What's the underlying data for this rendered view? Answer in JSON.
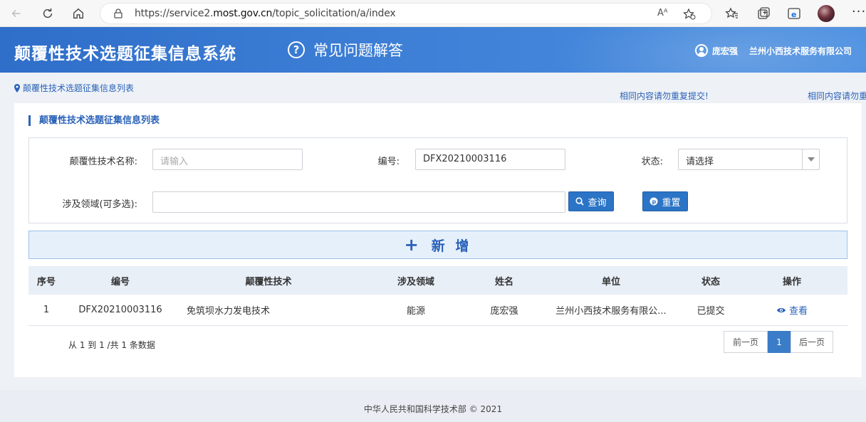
{
  "browser": {
    "url_prefix": "https://service2.",
    "url_domain": "most.gov.cn",
    "url_path": "/topic_solicitation/a/index",
    "read_aloud": "Aᴬ"
  },
  "header": {
    "title": "颠覆性技术选题征集信息系统",
    "faq_label": "常见问题解答",
    "user_name": "庞宏强",
    "company": "兰州小西技术服务有限公司"
  },
  "breadcrumb": {
    "label": "颠覆性技术选题征集信息列表"
  },
  "notices": [
    "相同内容请勿重复提交!",
    "相同内容请勿重"
  ],
  "section": {
    "title": "颠覆性技术选题征集信息列表"
  },
  "filters": {
    "name_label": "颠覆性技术名称:",
    "name_placeholder": "请输入",
    "code_label": "编号:",
    "code_value": "DFX20210003116",
    "status_label": "状态:",
    "status_value": "请选择",
    "field_label": "涉及领域(可多选):",
    "field_value": "",
    "search_button": "查询",
    "reset_button": "重置"
  },
  "add_button": "新 增",
  "table": {
    "headers": [
      "序号",
      "编号",
      "颠覆性技术",
      "涉及领域",
      "姓名",
      "单位",
      "状态",
      "操作"
    ],
    "rows": [
      [
        "1",
        "DFX20210003116",
        "免筑坝水力发电技术",
        "能源",
        "庞宏强",
        "兰州小西技术服务有限公...",
        "已提交",
        "查看"
      ]
    ]
  },
  "summary": "从 1 到 1 /共 1 条数据",
  "pagination": {
    "prev": "前一页",
    "current": "1",
    "next": "后一页"
  },
  "footer": "中华人民共和国科学技术部 © 2021",
  "colors": {
    "header": "#3d7fd6",
    "accent": "#2a62b8",
    "button": "#2b74c6"
  }
}
